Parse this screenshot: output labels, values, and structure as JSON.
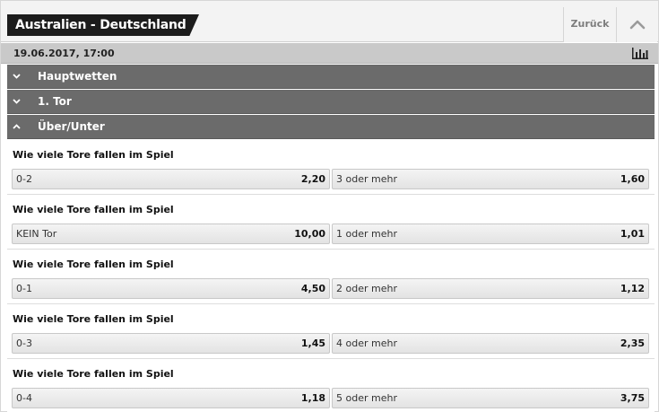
{
  "header": {
    "title": "Australien - Deutschland",
    "back_label": "Zurück"
  },
  "match": {
    "datetime": "19.06.2017, 17:00"
  },
  "sections": [
    {
      "label": "Hauptwetten",
      "expanded": false
    },
    {
      "label": "1. Tor",
      "expanded": false
    },
    {
      "label": "Über/Unter",
      "expanded": true
    }
  ],
  "markets": [
    {
      "question": "Wie viele Tore fallen im Spiel",
      "left": {
        "name": "0-2",
        "odd": "2,20"
      },
      "right": {
        "name": "3 oder mehr",
        "odd": "1,60"
      }
    },
    {
      "question": "Wie viele Tore fallen im Spiel",
      "left": {
        "name": "KEIN Tor",
        "odd": "10,00"
      },
      "right": {
        "name": "1 oder mehr",
        "odd": "1,01"
      }
    },
    {
      "question": "Wie viele Tore fallen im Spiel",
      "left": {
        "name": "0-1",
        "odd": "4,50"
      },
      "right": {
        "name": "2 oder mehr",
        "odd": "1,12"
      }
    },
    {
      "question": "Wie viele Tore fallen im Spiel",
      "left": {
        "name": "0-3",
        "odd": "1,45"
      },
      "right": {
        "name": "4 oder mehr",
        "odd": "2,35"
      }
    },
    {
      "question": "Wie viele Tore fallen im Spiel",
      "left": {
        "name": "0-4",
        "odd": "1,18"
      },
      "right": {
        "name": "5 oder mehr",
        "odd": "3,75"
      }
    }
  ],
  "icons": {
    "collapse": "chevron-up-icon",
    "stats": "bar-chart-icon",
    "section_collapsed": "chevron-down-icon",
    "section_expanded": "chevron-up-icon"
  }
}
